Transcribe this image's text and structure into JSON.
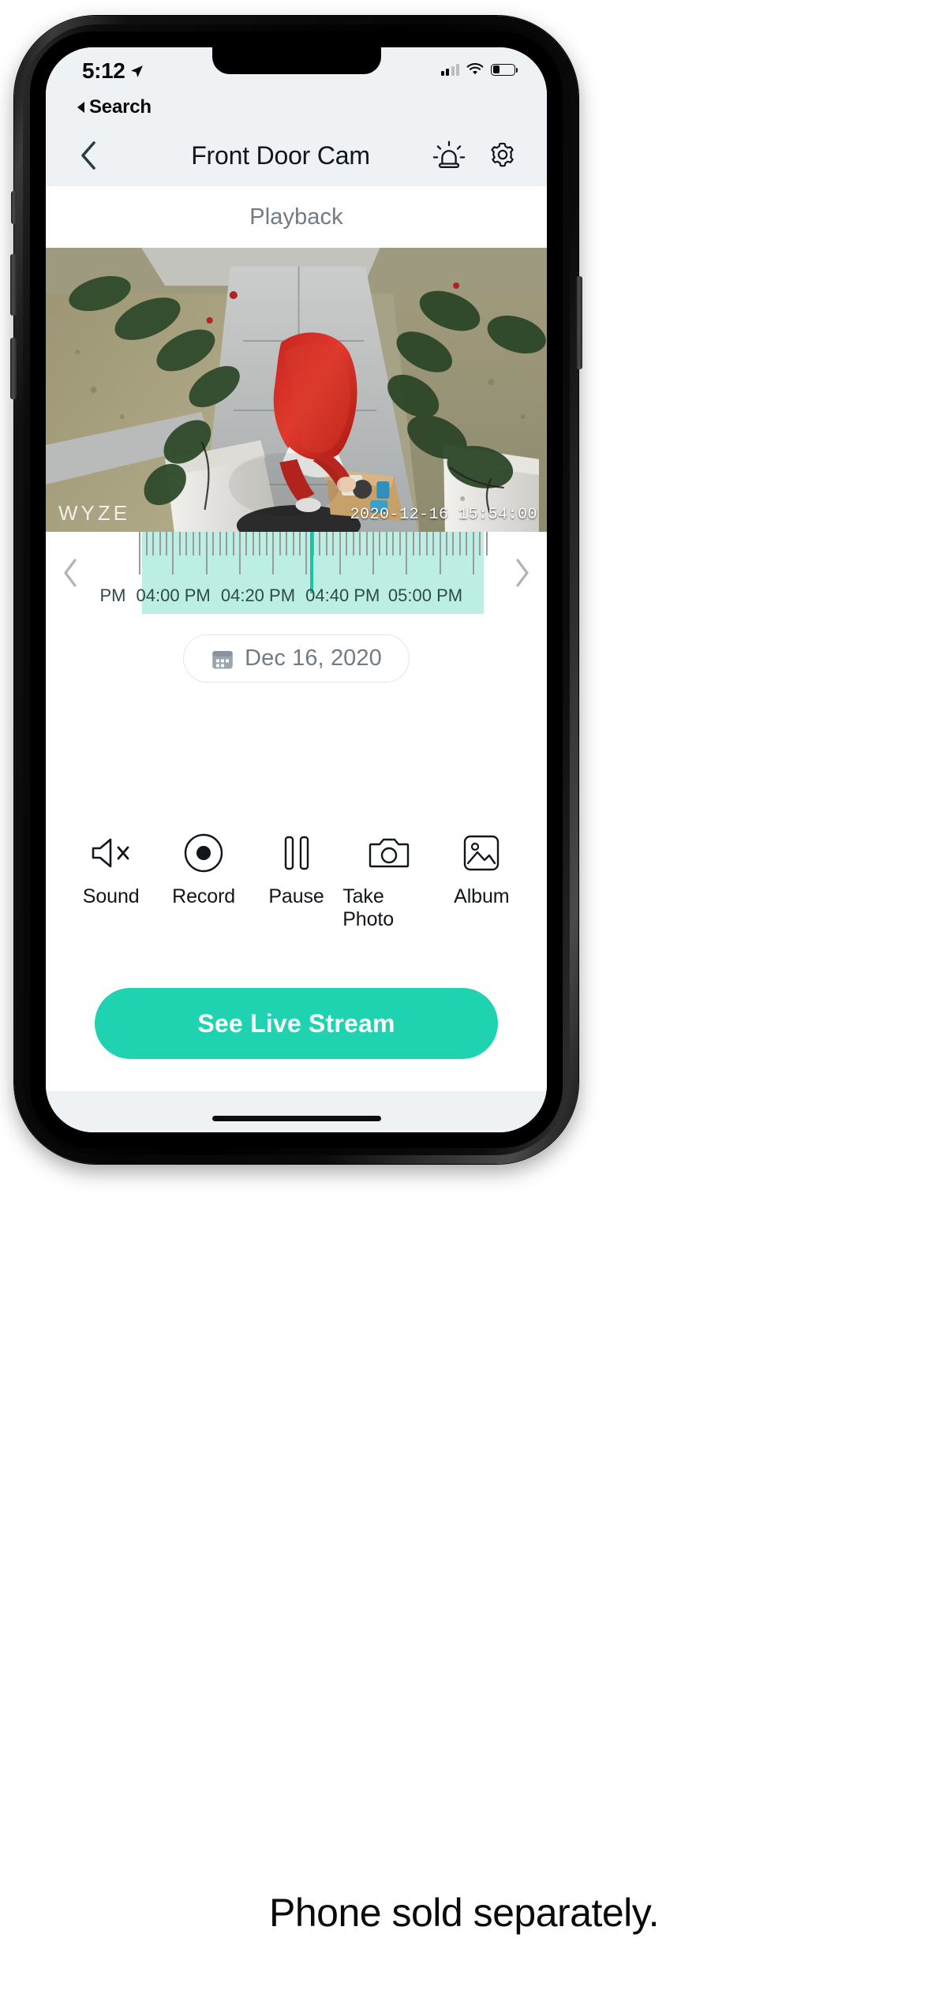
{
  "status_bar": {
    "time": "5:12",
    "location_icon": "location-arrow-icon",
    "cellular_icon": "cellular-bars-icon",
    "wifi_icon": "wifi-icon",
    "battery_icon": "battery-icon",
    "battery_level_pct": 32
  },
  "back_to_app": {
    "icon": "back-triangle-icon",
    "label": "Search"
  },
  "nav": {
    "back_icon": "chevron-left-icon",
    "title": "Front Door Cam",
    "siren_icon": "siren-icon",
    "settings_icon": "gear-icon"
  },
  "section": {
    "playback_label": "Playback"
  },
  "video": {
    "watermark": "WYZE",
    "timestamp": "2020-12-16 15:54:00"
  },
  "timeline": {
    "prev_icon": "chevron-left-icon",
    "next_icon": "chevron-right-icon",
    "labels": [
      "PM",
      "04:00 PM",
      "04:20 PM",
      "04:40 PM",
      "05:00 PM"
    ],
    "label_positions_pct": [
      4.5,
      19.5,
      40.5,
      61.5,
      82.0
    ],
    "playhead_pct": 53.5,
    "fill_color": "#bdeee4",
    "playhead_color": "#14c4a5",
    "tick_color": "#9a9a9a",
    "label_color": "#2d4b46"
  },
  "date_selector": {
    "calendar_icon": "calendar-icon",
    "label": "Dec 16, 2020"
  },
  "controls": [
    {
      "icon": "sound-muted-icon",
      "label": "Sound"
    },
    {
      "icon": "record-icon",
      "label": "Record"
    },
    {
      "icon": "pause-icon",
      "label": "Pause"
    },
    {
      "icon": "camera-icon",
      "label": "Take Photo"
    },
    {
      "icon": "album-icon",
      "label": "Album"
    }
  ],
  "cta": {
    "label": "See Live Stream",
    "color": "#1fd3b0"
  },
  "caption": {
    "text": "Phone sold separately."
  },
  "theme": {
    "accent": "#1fd3b0",
    "chrome_bg": "#eef2f5",
    "body_bg": "#ffffff",
    "muted_text": "#6f7c86",
    "primary_text": "#10161c"
  }
}
